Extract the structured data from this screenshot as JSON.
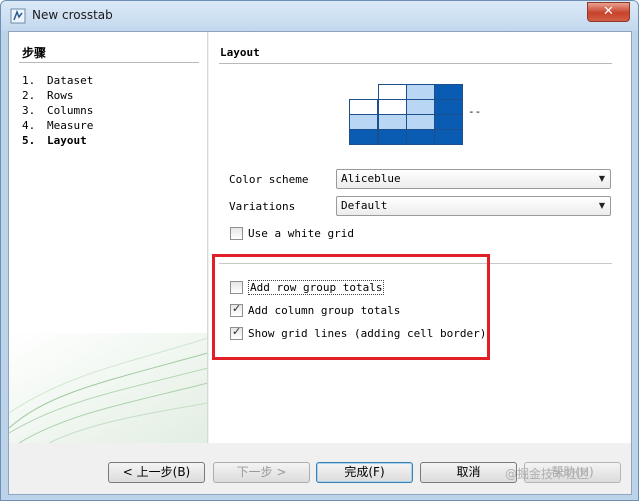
{
  "window": {
    "title": "New crosstab",
    "close_label": "✕"
  },
  "steps": {
    "title": "步骤",
    "items": [
      {
        "num": "1.",
        "label": "Dataset"
      },
      {
        "num": "2.",
        "label": "Rows"
      },
      {
        "num": "3.",
        "label": "Columns"
      },
      {
        "num": "4.",
        "label": "Measure"
      },
      {
        "num": "5.",
        "label": "Layout"
      }
    ],
    "active_index": 4
  },
  "layout_page": {
    "title": "Layout",
    "preview_suffix": "--",
    "color_scheme": {
      "label": "Color scheme",
      "value": "Aliceblue"
    },
    "variations": {
      "label": "Variations",
      "value": "Default"
    },
    "white_grid": {
      "label": "Use a white grid",
      "checked": false
    },
    "row_group_totals": {
      "label": "Add row group totals",
      "checked": false
    },
    "column_group_totals": {
      "label": "Add column group totals",
      "checked": true
    },
    "grid_lines": {
      "label": "Show grid lines (adding cell border)",
      "checked": true
    }
  },
  "buttons": {
    "back": "< 上一步(B)",
    "next": "下一步 >",
    "finish": "完成(F)",
    "cancel": "取消",
    "help": "帮助(H)"
  },
  "watermark": "@掘金技术社区",
  "colors": {
    "highlight": "#e01f26",
    "dark_blue": "#0a5cb3",
    "light_blue": "#b9d6f5",
    "white": "#ffffff"
  }
}
